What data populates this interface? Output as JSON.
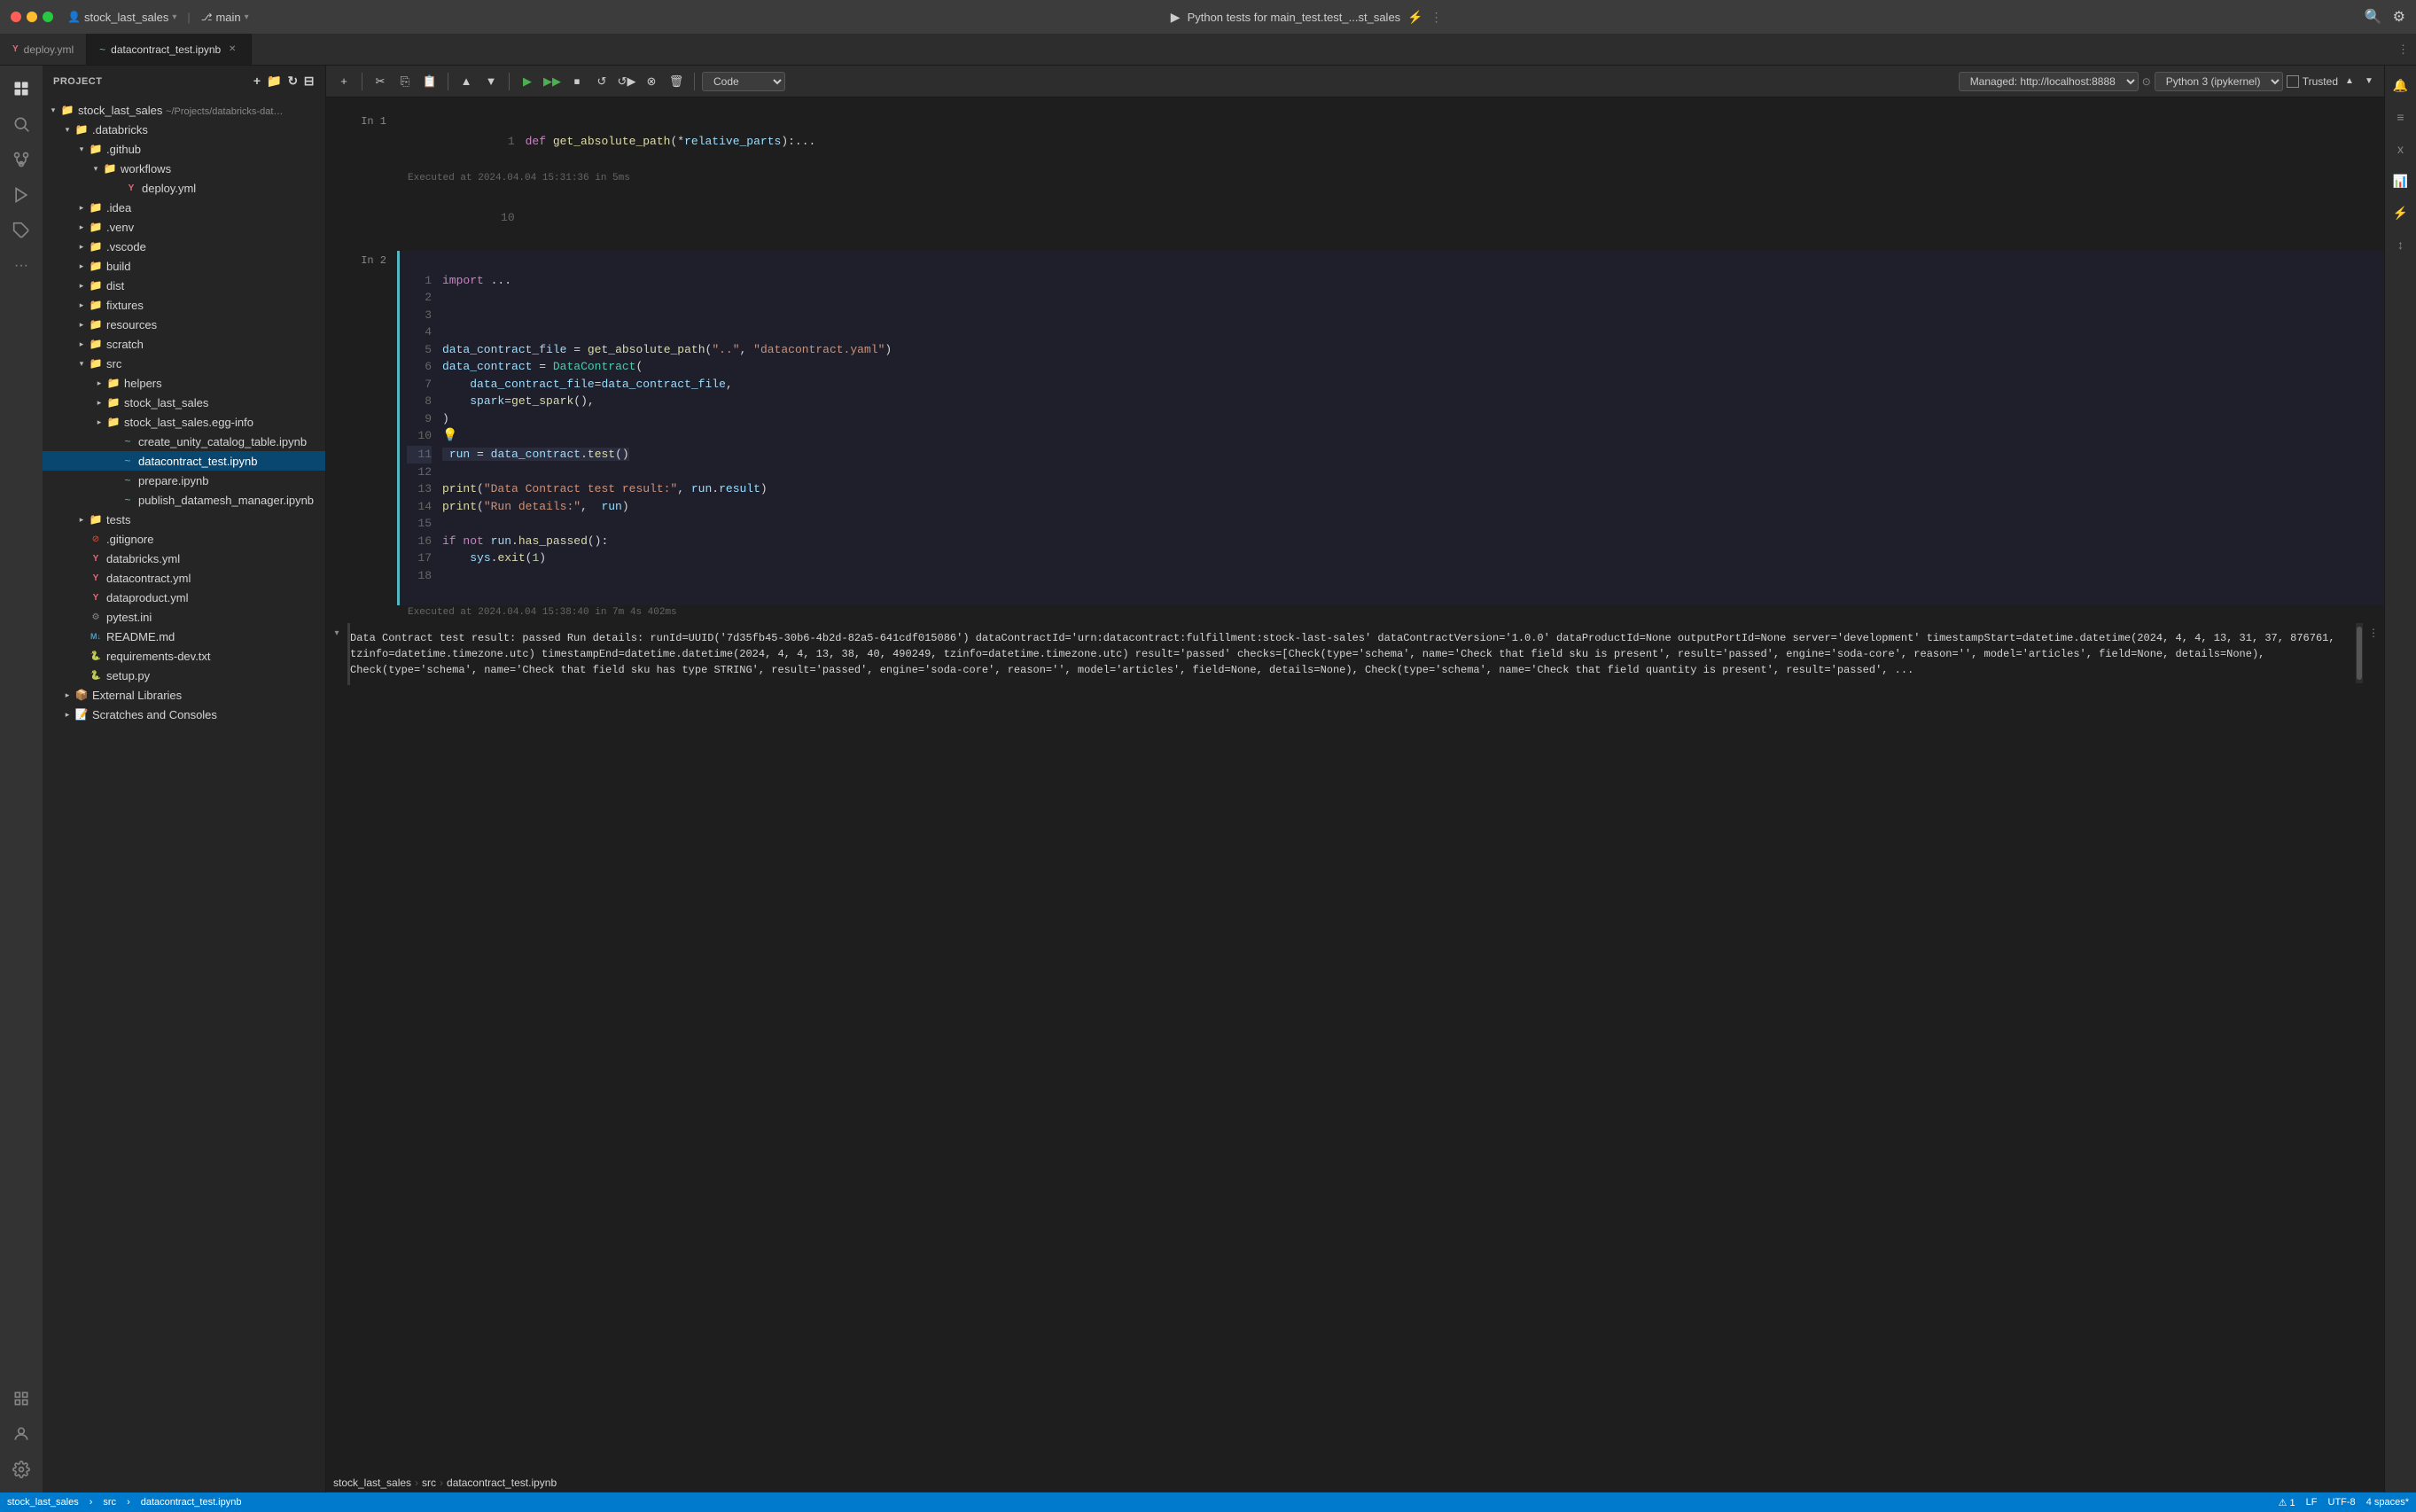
{
  "titlebar": {
    "project_name": "stock_last_sales",
    "branch_icon": "⎇",
    "branch_name": "main",
    "run_config": "Python tests for main_test.test_...st_sales",
    "search_icon": "🔍",
    "settings_icon": "⚙"
  },
  "tabs": [
    {
      "id": "deploy",
      "label": "deploy.yml",
      "icon": "Y",
      "icon_color": "#e06c75",
      "active": false,
      "closeable": false
    },
    {
      "id": "datacontract",
      "label": "datacontract_test.ipynb",
      "icon": "~",
      "icon_color": "#56b6c2",
      "active": true,
      "closeable": true
    }
  ],
  "toolbar": {
    "cell_type_label": "Code",
    "managed_url": "Managed: http://localhost:8888",
    "kernel_label": "Python 3 (ipykernel)",
    "trusted_label": "Trusted"
  },
  "sidebar": {
    "title": "Project",
    "root": {
      "name": "stock_last_sales",
      "path": "~/Projects/databricks-dat..."
    },
    "tree": [
      {
        "indent": 1,
        "type": "folder",
        "expanded": true,
        "label": ".databricks",
        "depth": 1
      },
      {
        "indent": 2,
        "type": "folder",
        "expanded": true,
        "label": ".github",
        "depth": 2
      },
      {
        "indent": 3,
        "type": "folder",
        "expanded": true,
        "label": "workflows",
        "depth": 3
      },
      {
        "indent": 4,
        "type": "file",
        "label": "deploy.yml",
        "icon_color": "#e06c75",
        "depth": 4
      },
      {
        "indent": 2,
        "type": "folder",
        "expanded": false,
        "label": ".idea",
        "depth": 2
      },
      {
        "indent": 2,
        "type": "folder",
        "expanded": false,
        "label": ".venv",
        "depth": 2
      },
      {
        "indent": 2,
        "type": "folder",
        "expanded": false,
        "label": ".vscode",
        "depth": 2
      },
      {
        "indent": 2,
        "type": "folder",
        "expanded": false,
        "label": "build",
        "depth": 2
      },
      {
        "indent": 2,
        "type": "folder",
        "expanded": false,
        "label": "dist",
        "depth": 2
      },
      {
        "indent": 2,
        "type": "folder",
        "expanded": false,
        "label": "fixtures",
        "depth": 2
      },
      {
        "indent": 2,
        "type": "folder",
        "expanded": false,
        "label": "resources",
        "depth": 2
      },
      {
        "indent": 2,
        "type": "folder",
        "expanded": false,
        "label": "scratch",
        "depth": 2
      },
      {
        "indent": 2,
        "type": "folder",
        "expanded": true,
        "label": "src",
        "depth": 2
      },
      {
        "indent": 3,
        "type": "folder",
        "expanded": false,
        "label": "helpers",
        "depth": 3
      },
      {
        "indent": 3,
        "type": "folder",
        "expanded": false,
        "label": "stock_last_sales",
        "depth": 3
      },
      {
        "indent": 3,
        "type": "folder",
        "expanded": false,
        "label": "stock_last_sales.egg-info",
        "depth": 3
      },
      {
        "indent": 3,
        "type": "nb",
        "label": "create_unity_catalog_table.ipynb",
        "depth": 3
      },
      {
        "indent": 3,
        "type": "nb",
        "label": "datacontract_test.ipynb",
        "selected": true,
        "depth": 3
      },
      {
        "indent": 3,
        "type": "nb",
        "label": "prepare.ipynb",
        "depth": 3
      },
      {
        "indent": 3,
        "type": "nb",
        "label": "publish_datamesh_manager.ipynb",
        "depth": 3
      },
      {
        "indent": 2,
        "type": "folder",
        "expanded": false,
        "label": "tests",
        "depth": 2
      },
      {
        "indent": 2,
        "type": "file-gitignore",
        "label": ".gitignore",
        "depth": 2
      },
      {
        "indent": 2,
        "type": "file-yaml",
        "label": "databricks.yml",
        "depth": 2
      },
      {
        "indent": 2,
        "type": "file-yaml",
        "label": "datacontract.yml",
        "depth": 2
      },
      {
        "indent": 2,
        "type": "file-yaml",
        "label": "dataproduct.yml",
        "depth": 2
      },
      {
        "indent": 2,
        "type": "file-ini",
        "label": "pytest.ini",
        "depth": 2
      },
      {
        "indent": 2,
        "type": "file-md",
        "label": "README.md",
        "depth": 2
      },
      {
        "indent": 2,
        "type": "file-py",
        "label": "requirements-dev.txt",
        "depth": 2
      },
      {
        "indent": 2,
        "type": "file-py",
        "label": "setup.py",
        "depth": 2
      },
      {
        "indent": 1,
        "type": "folder",
        "expanded": false,
        "label": "External Libraries",
        "depth": 1
      },
      {
        "indent": 1,
        "type": "folder",
        "expanded": false,
        "label": "Scratches and Consoles",
        "depth": 1
      }
    ]
  },
  "cells": [
    {
      "id": "cell1",
      "prompt": "In 1",
      "line_start": 1,
      "executed_at": "Executed at 2024.04.04 15:31:36 in 5ms",
      "lines": [
        {
          "num": 1,
          "content": "def get_absolute_path(*relative_parts):..."
        }
      ]
    },
    {
      "id": "cell2",
      "prompt": "In 2",
      "line_start": 1,
      "active": true,
      "executed_at": "Executed at 2024.04.04 15:38:40 in 7m 4s 402ms",
      "lines": [
        {
          "num": 1,
          "content_raw": "import ..."
        },
        {
          "num": 2,
          "content_raw": ""
        },
        {
          "num": 3,
          "content_raw": ""
        },
        {
          "num": 4,
          "content_raw": ""
        },
        {
          "num": 5,
          "content_raw": "data_contract_file = get_absolute_path(\"..\", \"datacontract.yaml\")"
        },
        {
          "num": 6,
          "content_raw": "data_contract = DataContract("
        },
        {
          "num": 7,
          "content_raw": "    data_contract_file=data_contract_file,"
        },
        {
          "num": 8,
          "content_raw": "    spark=get_spark(),"
        },
        {
          "num": 9,
          "content_raw": ")"
        },
        {
          "num": 10,
          "content_raw": "💡"
        },
        {
          "num": 11,
          "content_raw": "run = data_contract.test()"
        },
        {
          "num": 12,
          "content_raw": ""
        },
        {
          "num": 13,
          "content_raw": "print(\"Data Contract test result:\", run.result)"
        },
        {
          "num": 14,
          "content_raw": "print(\"Run details:\",  run)"
        },
        {
          "num": 15,
          "content_raw": ""
        },
        {
          "num": 16,
          "content_raw": "if not run.has_passed():"
        },
        {
          "num": 17,
          "content_raw": "    sys.exit(1)"
        },
        {
          "num": 18,
          "content_raw": ""
        }
      ],
      "output": {
        "text": "Data Contract test result: passed\nRun details: runId=UUID('7d35fb45-30b6-4b2d-82a5-641cdf015086')\ndataContractId='urn:datacontract:fulfillment:stock-last-sales' dataContractVersion='1.0.0'\ndataProductId=None outputPortId=None server='development' timestampStart=datetime.datetime(2024,\n4, 4, 13, 31, 37, 876761, tzinfo=datetime.timezone.utc) timestampEnd=datetime.datetime(2024, 4,\n4, 13, 38, 40, 490249, tzinfo=datetime.timezone.utc) result='passed' checks=[Check(type='schema',\n name='Check that field sku is present', result='passed', engine='soda-core', reason='',\nmodel='articles', field=None, details=None), Check(type='schema', name='Check that field sku has\ntype STRING', result='passed', engine='soda-core', reason='', model='articles', field=None,\ndetails=None), Check(type='schema', name='Check that field quantity is present', result='passed',\n..."
      }
    }
  ],
  "breadcrumb": {
    "items": [
      "stock_last_sales",
      "src",
      "datacontract_test.ipynb"
    ]
  },
  "statusbar": {
    "branch": "stock_last_sales",
    "path": "src",
    "file": "datacontract_test.ipynb",
    "encoding": "LF",
    "charset": "UTF-8",
    "indent": "4 spaces*"
  }
}
